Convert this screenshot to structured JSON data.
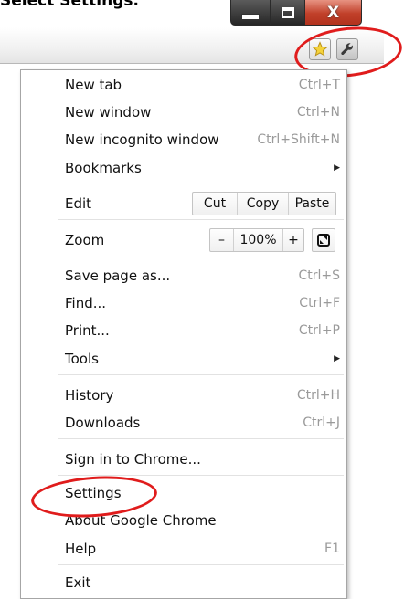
{
  "caption": "Select Settings.",
  "window_controls": {
    "minimize": "minimize-icon",
    "maximize": "maximize-icon",
    "close_label": "X"
  },
  "toolbar": {
    "bookmark_icon": "star-icon",
    "menu_icon": "wrench-icon"
  },
  "menu": {
    "new_tab": {
      "label": "New tab",
      "shortcut": "Ctrl+T"
    },
    "new_window": {
      "label": "New window",
      "shortcut": "Ctrl+N"
    },
    "new_incognito": {
      "label": "New incognito window",
      "shortcut": "Ctrl+Shift+N"
    },
    "bookmarks": {
      "label": "Bookmarks"
    },
    "edit": {
      "label": "Edit",
      "cut": "Cut",
      "copy": "Copy",
      "paste": "Paste"
    },
    "zoom": {
      "label": "Zoom",
      "minus": "–",
      "value": "100%",
      "plus": "+"
    },
    "save_page": {
      "label": "Save page as...",
      "shortcut": "Ctrl+S"
    },
    "find": {
      "label": "Find...",
      "shortcut": "Ctrl+F"
    },
    "print": {
      "label": "Print...",
      "shortcut": "Ctrl+P"
    },
    "tools": {
      "label": "Tools"
    },
    "history": {
      "label": "History",
      "shortcut": "Ctrl+H"
    },
    "downloads": {
      "label": "Downloads",
      "shortcut": "Ctrl+J"
    },
    "sign_in": {
      "label": "Sign in to Chrome..."
    },
    "settings": {
      "label": "Settings"
    },
    "about": {
      "label": "About Google Chrome"
    },
    "help": {
      "label": "Help",
      "shortcut": "F1"
    },
    "exit": {
      "label": "Exit"
    }
  },
  "colors": {
    "highlight": "#e01c1c",
    "star": "#f4d23a",
    "close": "#c1402a"
  }
}
